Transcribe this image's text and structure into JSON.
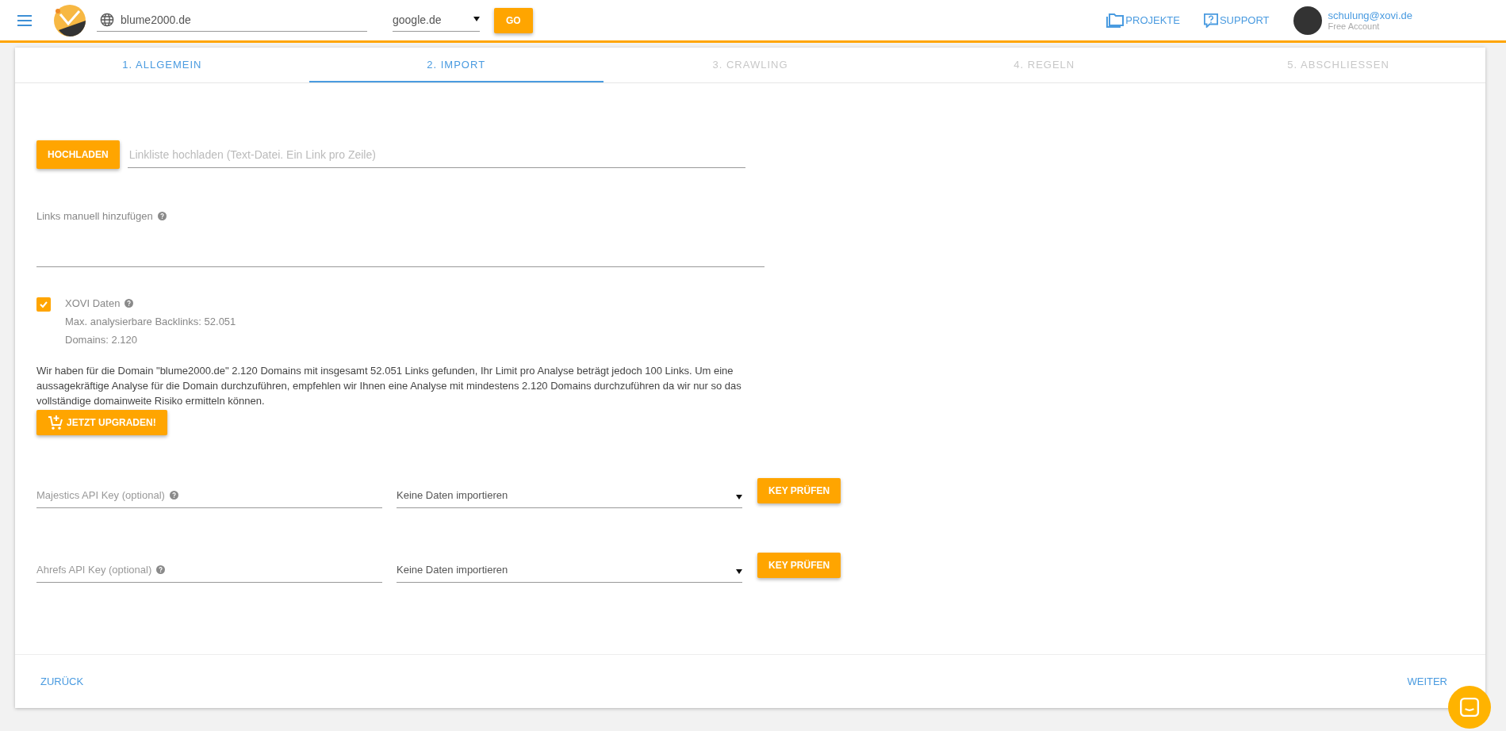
{
  "header": {
    "domain": "blume2000.de",
    "search_engine": "google.de",
    "go": "GO",
    "nav": [
      {
        "kind": "folder",
        "label": "PROJEKTE"
      },
      {
        "kind": "support",
        "label": "SUPPORT"
      }
    ],
    "user": {
      "email": "schulung@xovi.de",
      "plan": "Free Account"
    }
  },
  "steps": [
    {
      "label": "1. ALLGEMEIN",
      "selected": false,
      "disabled": false
    },
    {
      "label": "2. IMPORT",
      "selected": true,
      "disabled": false
    },
    {
      "label": "3. CRAWLING",
      "selected": false,
      "disabled": true
    },
    {
      "label": "4. REGELN",
      "selected": false,
      "disabled": true
    },
    {
      "label": "5. ABSCHLIESSEN",
      "selected": false,
      "disabled": true
    }
  ],
  "upload": {
    "button": "HOCHLADEN",
    "placeholder": "Linkliste hochladen (Text-Datei. Ein Link pro Zeile)"
  },
  "manual": {
    "label": "Links manuell hinzufügen"
  },
  "xovi": {
    "label": "XOVI Daten",
    "checked": true,
    "lines": [
      "Max. analysierbare Backlinks: 52.051",
      "Domains: 2.120"
    ]
  },
  "notice": "Wir haben für die Domain \"blume2000.de\" 2.120 Domains mit insgesamt 52.051 Links gefunden, Ihr Limit pro Analyse beträgt jedoch 100 Links. Um eine aussagekräftige Analyse für die Domain durchzuführen, empfehlen wir Ihnen eine Analyse mit mindestens 2.120 Domains durchzuführen da wir nur so das vollständige domainweite Risiko ermitteln können.",
  "upgrade": "JETZT UPGRADEN!",
  "api_keys": [
    {
      "label": "Majestics API Key (optional)",
      "select": "Keine Daten importieren",
      "button": "KEY PRÜFEN"
    },
    {
      "label": "Ahrefs API Key (optional)",
      "select": "Keine Daten importieren",
      "button": "KEY PRÜFEN"
    }
  ],
  "footer": {
    "back": "ZURÜCK",
    "next": "WEITER"
  }
}
